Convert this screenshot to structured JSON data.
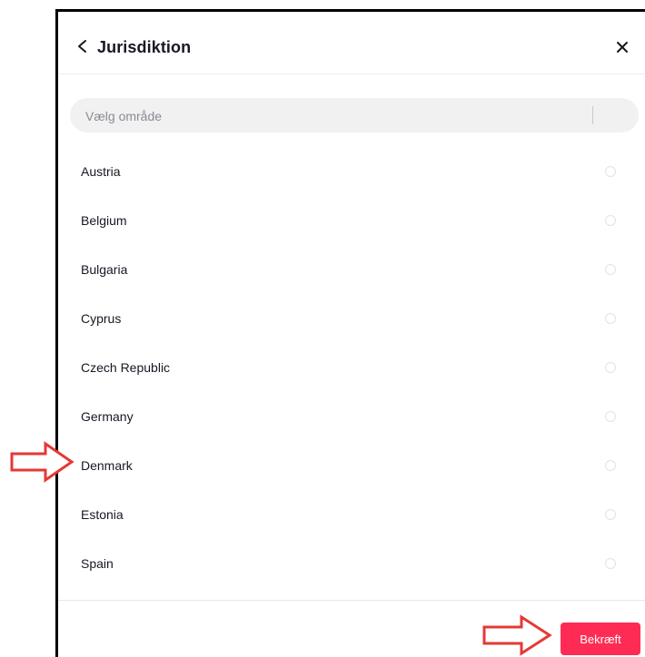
{
  "dialog": {
    "title": "Jurisdiktion",
    "back_icon": "chevron-left-icon",
    "close_icon": "close-icon"
  },
  "search": {
    "placeholder": "Vælg område",
    "value": ""
  },
  "countries": [
    {
      "label": "Austria",
      "selected": false
    },
    {
      "label": "Belgium",
      "selected": false
    },
    {
      "label": "Bulgaria",
      "selected": false
    },
    {
      "label": "Cyprus",
      "selected": false
    },
    {
      "label": "Czech Republic",
      "selected": false
    },
    {
      "label": "Germany",
      "selected": false
    },
    {
      "label": "Denmark",
      "selected": false
    },
    {
      "label": "Estonia",
      "selected": false
    },
    {
      "label": "Spain",
      "selected": false
    }
  ],
  "footer": {
    "confirm_label": "Bekræft"
  },
  "annotations": {
    "arrow_icon": "red-outline-arrow-icon",
    "arrow_color": "#e53935"
  },
  "colors": {
    "accent": "#fe2c55",
    "text": "#161823",
    "placeholder": "#8a8b91",
    "search_bg": "#f1f1f2"
  }
}
